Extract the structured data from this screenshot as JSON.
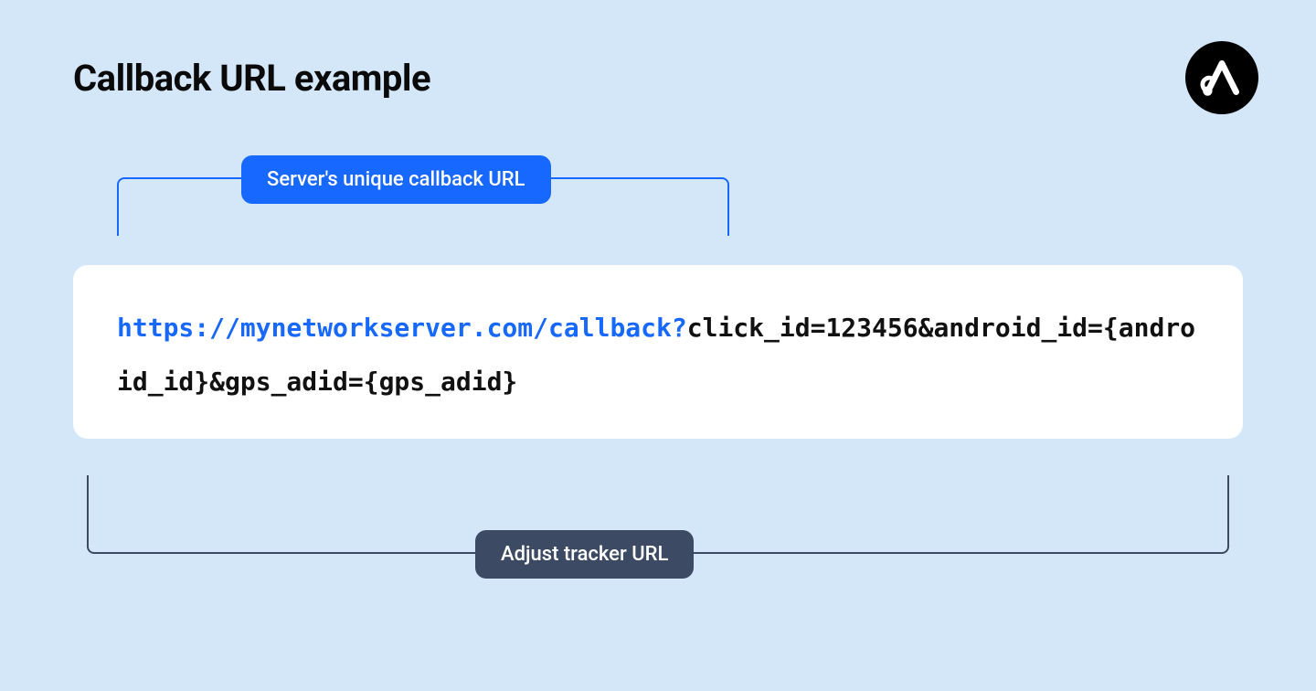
{
  "title": "Callback URL example",
  "labels": {
    "server_callback": "Server's unique callback URL",
    "tracker_url": "Adjust tracker URL"
  },
  "url": {
    "base": "https://mynetworkserver.com/callback?",
    "params": "click_id=123456&android_id={android_id}&gps_adid={gps_adid}"
  },
  "logo_name": "adjust-logo"
}
